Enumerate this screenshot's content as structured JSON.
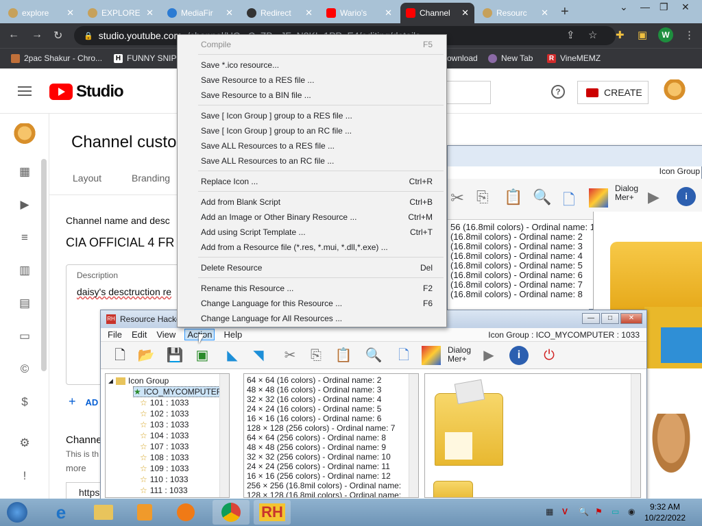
{
  "browser": {
    "tabs": [
      {
        "label": "explore",
        "color": "#c6a15b"
      },
      {
        "label": "EXPLORE",
        "color": "#c6a15b"
      },
      {
        "label": "MediaFir",
        "color": "#2b7bd3"
      },
      {
        "label": "Redirect",
        "color": "#333333"
      },
      {
        "label": "Wario's",
        "color": "#ff0000"
      },
      {
        "label": "Channel",
        "color": "#ff0000"
      },
      {
        "label": "Resourc",
        "color": "#c6a15b"
      }
    ],
    "url_main": "studio.youtube.com",
    "url_rest": "/channel/UC...C_ZB...JF_N2KL-1PP_E4/editing/details",
    "profile_letter": "W",
    "bookmarks": [
      "2pac Shakur - Chro...",
      "FUNNY SNIP",
      "ownload",
      "New Tab",
      "VineMEMZ"
    ]
  },
  "studio": {
    "logo_text": "Studio",
    "create_label": "CREATE",
    "help_glyph": "?",
    "page_title": "Channel custor",
    "tabs": [
      "Layout",
      "Branding"
    ],
    "section_label": "Channel name and desc",
    "channel_name": "CIA OFFICIAL 4 FR",
    "description_label": "Description",
    "description_text": "daisy's desctruction re",
    "add_label": "AD",
    "channel_url_label": "Channe",
    "channel_url_hint": "This is th",
    "more_label": "more",
    "url_value": "https"
  },
  "back_window": {
    "header_right": "Icon Group",
    "list": [
      "56 (16.8mil colors) - Ordinal name: 1",
      "(16.8mil colors) - Ordinal name: 2",
      "(16.8mil colors) - Ordinal name: 3",
      "(16.8mil colors) - Ordinal name: 4",
      "(16.8mil colors) - Ordinal name: 5",
      "(16.8mil colors) - Ordinal name: 6",
      "(16.8mil colors) - Ordinal name: 7",
      "(16.8mil colors) - Ordinal name: 8"
    ],
    "dialog_label": "Dialog\nMer+"
  },
  "rh": {
    "title": "Resource Hacke",
    "menus": [
      "File",
      "Edit",
      "View",
      "Action",
      "Help"
    ],
    "status": "Icon Group : ICO_MYCOMPUTER : 1033",
    "tree_root": "Icon Group",
    "tree_selected": "ICO_MYCOMPUTER",
    "tree_items": [
      "101 : 1033",
      "102 : 1033",
      "103 : 1033",
      "104 : 1033",
      "107 : 1033",
      "108 : 1033",
      "109 : 1033",
      "110 : 1033",
      "111 : 1033"
    ],
    "list": [
      "64 × 64 (16 colors) - Ordinal name: 2",
      "48 × 48 (16 colors) - Ordinal name: 3",
      "32 × 32 (16 colors) - Ordinal name: 4",
      "24 × 24 (16 colors) - Ordinal name: 5",
      "16 × 16 (16 colors) - Ordinal name: 6",
      "128 × 128 (256 colors) - Ordinal name: 7",
      "64 × 64 (256 colors) - Ordinal name: 8",
      "48 × 48 (256 colors) - Ordinal name: 9",
      "32 × 32 (256 colors) - Ordinal name: 10",
      "24 × 24 (256 colors) - Ordinal name: 11",
      "16 × 16 (256 colors) - Ordinal name: 12",
      "256 × 256 (16.8mil colors) - Ordinal name:",
      "128 × 128 (16.8mil colors) - Ordinal name:"
    ],
    "dialog_label": "Dialog\nMer+"
  },
  "context_menu": {
    "items": [
      {
        "label": "Compile",
        "shortcut": "F5",
        "disabled": true
      },
      {
        "label": "Save *.ico resource...",
        "shortcut": ""
      },
      {
        "label": "Save Resource to a RES file ...",
        "shortcut": ""
      },
      {
        "label": "Save Resource to a BIN file ...",
        "shortcut": ""
      },
      {
        "label": "Save [ Icon Group ] group to a RES file ...",
        "shortcut": ""
      },
      {
        "label": "Save [ Icon Group ] group to an RC file ...",
        "shortcut": ""
      },
      {
        "label": "Save ALL Resources to a RES file ...",
        "shortcut": ""
      },
      {
        "label": "Save ALL Resources to an RC file ...",
        "shortcut": ""
      },
      {
        "label": "Replace Icon ...",
        "shortcut": "Ctrl+R"
      },
      {
        "label": "Add from Blank Script",
        "shortcut": "Ctrl+B"
      },
      {
        "label": "Add an Image or Other Binary Resource ...",
        "shortcut": "Ctrl+M"
      },
      {
        "label": "Add using Script Template ...",
        "shortcut": "Ctrl+T"
      },
      {
        "label": "Add from a Resource file (*.res, *.mui, *.dll,*.exe) ...",
        "shortcut": ""
      },
      {
        "label": "Delete Resource",
        "shortcut": "Del"
      },
      {
        "label": "Rename this Resource ...",
        "shortcut": "F2"
      },
      {
        "label": "Change Language for this Resource ...",
        "shortcut": "F6"
      },
      {
        "label": "Change Language for All Resources ...",
        "shortcut": ""
      }
    ]
  },
  "taskbar": {
    "time": "9:32 AM",
    "date": "10/22/2022",
    "rh_label": "RH"
  }
}
